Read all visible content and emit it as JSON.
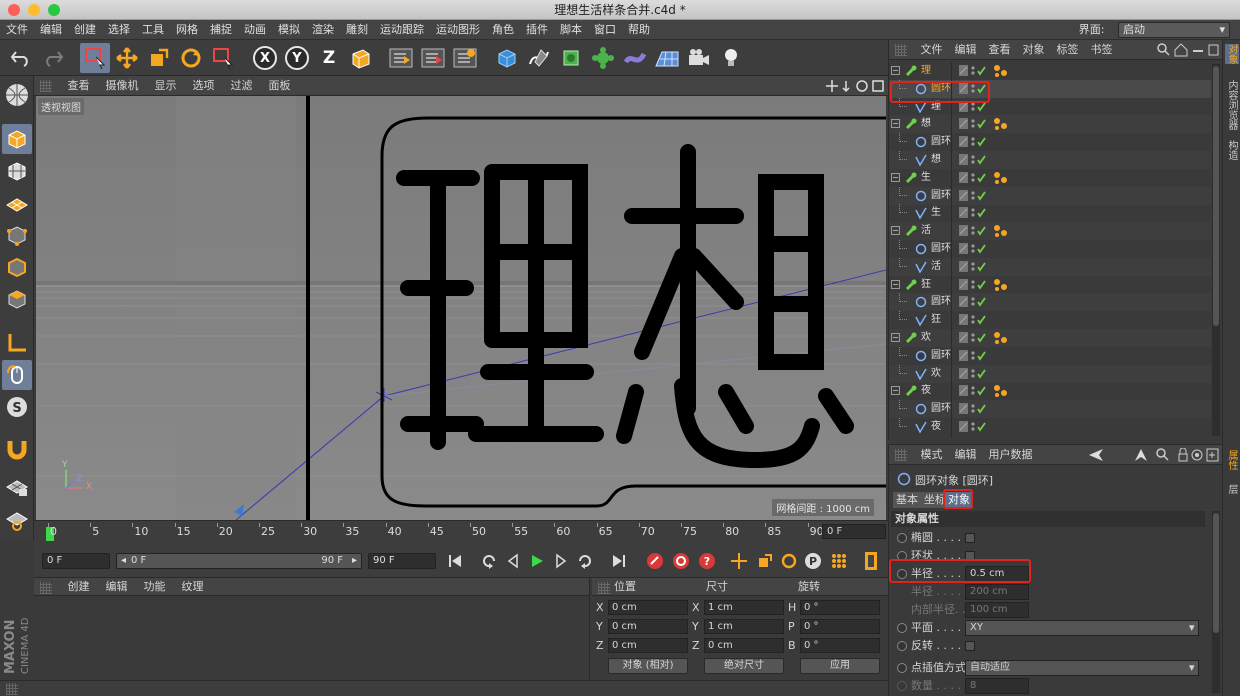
{
  "window": {
    "title": "理想生活样条合并.c4d *"
  },
  "menubar": {
    "items": [
      "文件",
      "编辑",
      "创建",
      "选择",
      "工具",
      "网格",
      "捕捉",
      "动画",
      "模拟",
      "渲染",
      "雕刻",
      "运动跟踪",
      "运动图形",
      "角色",
      "插件",
      "脚本",
      "窗口",
      "帮助"
    ],
    "interface_label": "界面:",
    "interface_value": "启动"
  },
  "toolbar": {
    "axis_x": "X",
    "axis_y": "Y",
    "axis_z": "Z"
  },
  "viewport": {
    "menu": [
      "查看",
      "摄像机",
      "显示",
      "选项",
      "过滤",
      "面板"
    ],
    "label": "透视视图",
    "grid_spacing": "网格间距 : 1000 cm",
    "axis_y": "Y",
    "axis_x": "X",
    "axis_z": "Z",
    "big_text": "理想"
  },
  "timeline": {
    "ticks": [
      "0",
      "5",
      "10",
      "15",
      "20",
      "25",
      "30",
      "35",
      "40",
      "45",
      "50",
      "55",
      "60",
      "65",
      "70",
      "75",
      "80",
      "85",
      "90"
    ],
    "current_frame": "0 F"
  },
  "transport": {
    "start": "0 F",
    "range_start": "0 F",
    "range_end": "90 F",
    "end": "90 F"
  },
  "materials": {
    "menu": [
      "创建",
      "编辑",
      "功能",
      "纹理"
    ]
  },
  "coordinates": {
    "headers": [
      "位置",
      "尺寸",
      "旋转"
    ],
    "rows": [
      {
        "pos_axis": "X",
        "pos": "0 cm",
        "size_axis": "X",
        "size": "1 cm",
        "rot_axis": "H",
        "rot": "0 °"
      },
      {
        "pos_axis": "Y",
        "pos": "0 cm",
        "size_axis": "Y",
        "size": "1 cm",
        "rot_axis": "P",
        "rot": "0 °"
      },
      {
        "pos_axis": "Z",
        "pos": "0 cm",
        "size_axis": "Z",
        "size": "0 cm",
        "rot_axis": "B",
        "rot": "0 °"
      }
    ],
    "mode": "对象 (相对)",
    "size_mode": "绝对尺寸",
    "apply": "应用"
  },
  "object_manager": {
    "menu": [
      "文件",
      "编辑",
      "查看",
      "对象",
      "标签",
      "书签"
    ],
    "rows": [
      {
        "name": "理",
        "level": 0,
        "type": "group",
        "highlight": true
      },
      {
        "name": "圆环",
        "level": 1,
        "type": "circle",
        "selected": true
      },
      {
        "name": "理",
        "level": 1,
        "type": "spline"
      },
      {
        "name": "想",
        "level": 0,
        "type": "group"
      },
      {
        "name": "圆环",
        "level": 1,
        "type": "circle"
      },
      {
        "name": "想",
        "level": 1,
        "type": "spline"
      },
      {
        "name": "生",
        "level": 0,
        "type": "group"
      },
      {
        "name": "圆环",
        "level": 1,
        "type": "circle"
      },
      {
        "name": "生",
        "level": 1,
        "type": "spline"
      },
      {
        "name": "活",
        "level": 0,
        "type": "group"
      },
      {
        "name": "圆环",
        "level": 1,
        "type": "circle"
      },
      {
        "name": "活",
        "level": 1,
        "type": "spline"
      },
      {
        "name": "狂",
        "level": 0,
        "type": "group"
      },
      {
        "name": "圆环",
        "level": 1,
        "type": "circle"
      },
      {
        "name": "狂",
        "level": 1,
        "type": "spline"
      },
      {
        "name": "欢",
        "level": 0,
        "type": "group"
      },
      {
        "name": "圆环",
        "level": 1,
        "type": "circle"
      },
      {
        "name": "欢",
        "level": 1,
        "type": "spline"
      },
      {
        "name": "夜",
        "level": 0,
        "type": "group"
      },
      {
        "name": "圆环",
        "level": 1,
        "type": "circle"
      },
      {
        "name": "夜",
        "level": 1,
        "type": "spline"
      }
    ]
  },
  "right_tabs": [
    "对象",
    "内容浏览器",
    "构造",
    "属性",
    "层"
  ],
  "attribute_manager": {
    "menu": [
      "模式",
      "编辑",
      "用户数据"
    ],
    "object_title": "圆环对象 [圆环]",
    "tabs": [
      "基本",
      "坐标",
      "对象"
    ],
    "section": "对象属性",
    "props": [
      {
        "label": "椭圆 . . . . .",
        "kind": "check"
      },
      {
        "label": "环状 . . . . .",
        "kind": "check"
      },
      {
        "label": "半径 . . . . .",
        "kind": "value",
        "value": "0.5 cm"
      },
      {
        "label": "半径 . . . . .",
        "kind": "value",
        "value": "200 cm",
        "disabled": true
      },
      {
        "label": "内部半径. . .",
        "kind": "value",
        "value": "100 cm",
        "disabled": true
      },
      {
        "label": "平面 . . . . .",
        "kind": "select",
        "value": "XY"
      },
      {
        "label": "反转 . . . . .",
        "kind": "check"
      },
      {
        "label": "点插值方式",
        "kind": "select",
        "value": "自动适应"
      },
      {
        "label": "数量 . . . . .",
        "kind": "value",
        "value": "8",
        "disabled": true
      }
    ]
  },
  "maxon": {
    "brand": "MAXON",
    "product": "CINEMA 4D"
  },
  "colors": {
    "accent_orange": "#f5a623",
    "highlight_red": "#e0241b",
    "selection_blue": "#6f7f99",
    "check_green": "#6fd14b"
  }
}
